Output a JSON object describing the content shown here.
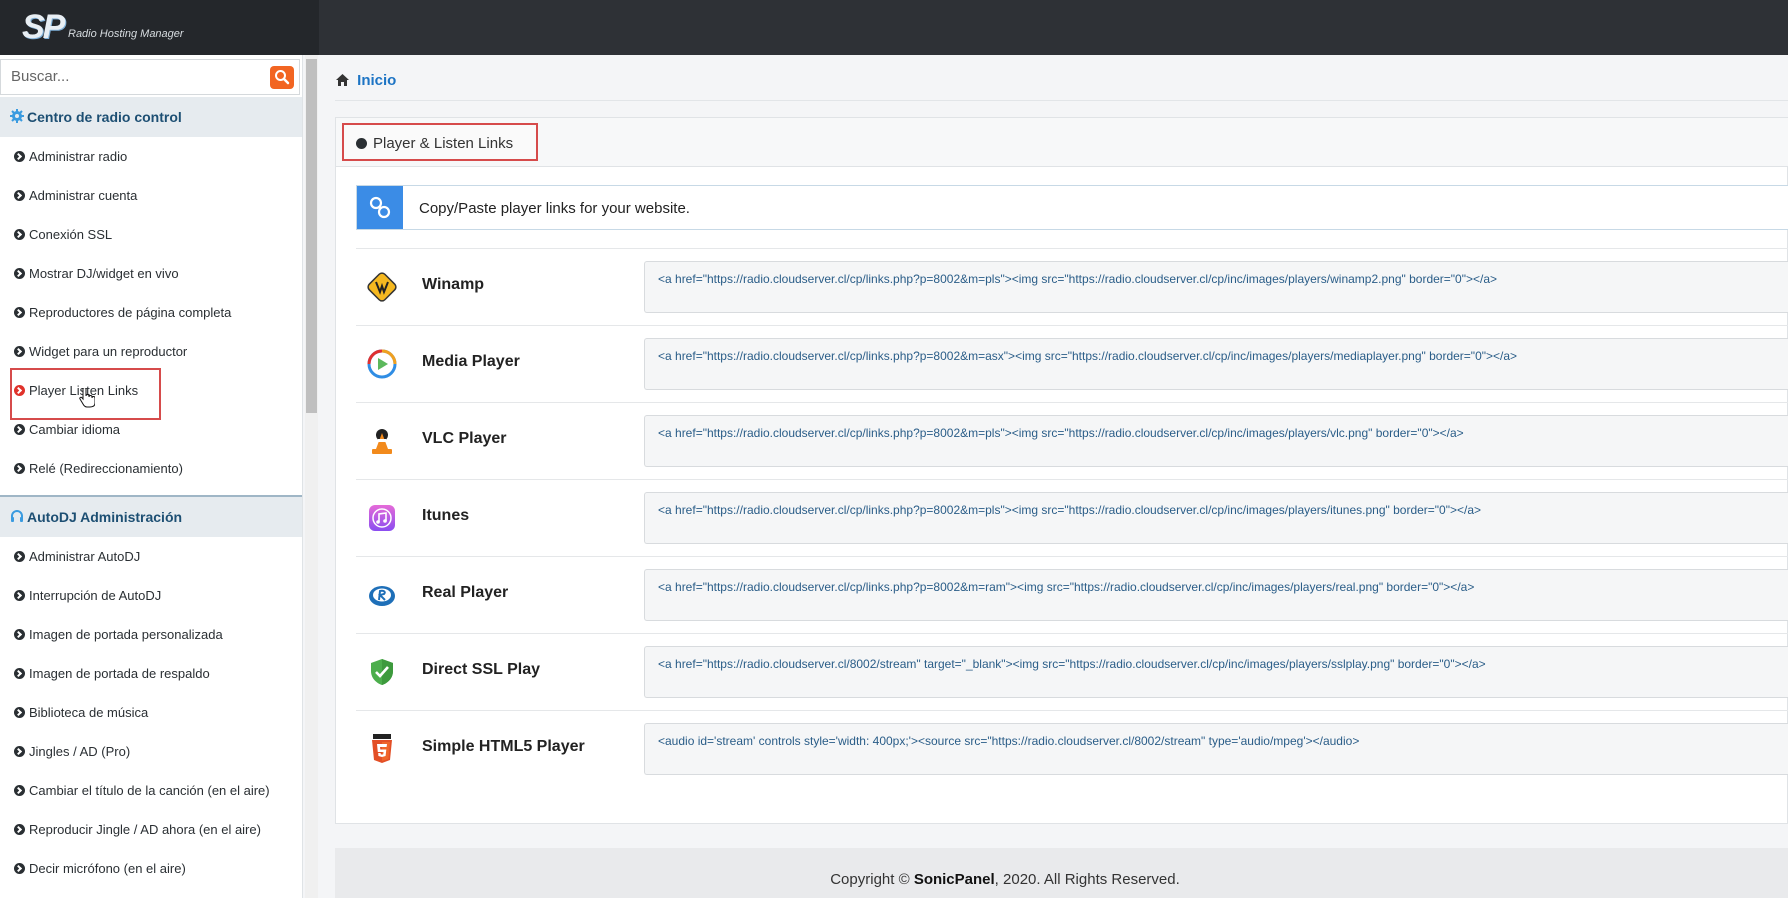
{
  "brand": {
    "logo_mark": "SP",
    "logo_subtitle": "Radio Hosting Manager"
  },
  "search": {
    "placeholder": "Buscar...",
    "icon": "search-icon"
  },
  "sidebar": {
    "sections": [
      {
        "title": "Centro de radio control",
        "icon": "gear-icon",
        "items": [
          {
            "label": "Administrar radio"
          },
          {
            "label": "Administrar cuenta"
          },
          {
            "label": "Conexión SSL"
          },
          {
            "label": "Mostrar DJ/widget en vivo"
          },
          {
            "label": "Reproductores de página completa"
          },
          {
            "label": "Widget para un reproductor"
          },
          {
            "label": "Player Listen Links",
            "active": true
          },
          {
            "label": "Cambiar idioma"
          },
          {
            "label": "Relé (Redireccionamiento)"
          }
        ]
      },
      {
        "title": "AutoDJ Administración",
        "icon": "headphones-icon",
        "items": [
          {
            "label": "Administrar AutoDJ"
          },
          {
            "label": "Interrupción de AutoDJ"
          },
          {
            "label": "Imagen de portada personalizada"
          },
          {
            "label": "Imagen de portada de respaldo"
          },
          {
            "label": "Biblioteca de música"
          },
          {
            "label": "Jingles / AD (Pro)"
          },
          {
            "label": "Cambiar el título de la canción (en el aire)"
          },
          {
            "label": "Reproducir Jingle / AD ahora (en el aire)"
          },
          {
            "label": "Decir micrófono (en el aire)"
          }
        ]
      }
    ]
  },
  "breadcrumb": {
    "label": "Inicio",
    "icon": "home-icon"
  },
  "panel": {
    "title": "Player & Listen Links",
    "info": "Copy/Paste player links for your website.",
    "info_icon": "link-icon"
  },
  "players": [
    {
      "name": "Winamp",
      "icon": "winamp-icon",
      "code": "<a href=\"https://radio.cloudserver.cl/cp/links.php?p=8002&m=pls\"><img src=\"https://radio.cloudserver.cl/cp/inc/images/players/winamp2.png\" border=\"0\"></a>"
    },
    {
      "name": "Media Player",
      "icon": "media-player-icon",
      "code": "<a href=\"https://radio.cloudserver.cl/cp/links.php?p=8002&m=asx\"><img src=\"https://radio.cloudserver.cl/cp/inc/images/players/mediaplayer.png\" border=\"0\"></a>"
    },
    {
      "name": "VLC Player",
      "icon": "vlc-icon",
      "code": "<a href=\"https://radio.cloudserver.cl/cp/links.php?p=8002&m=pls\"><img src=\"https://radio.cloudserver.cl/cp/inc/images/players/vlc.png\" border=\"0\"></a>"
    },
    {
      "name": "Itunes",
      "icon": "itunes-icon",
      "code": "<a href=\"https://radio.cloudserver.cl/cp/links.php?p=8002&m=pls\"><img src=\"https://radio.cloudserver.cl/cp/inc/images/players/itunes.png\" border=\"0\"></a>"
    },
    {
      "name": "Real Player",
      "icon": "real-player-icon",
      "code": "<a href=\"https://radio.cloudserver.cl/cp/links.php?p=8002&m=ram\"><img src=\"https://radio.cloudserver.cl/cp/inc/images/players/real.png\" border=\"0\"></a>"
    },
    {
      "name": "Direct SSL Play",
      "icon": "ssl-shield-icon",
      "code": "<a href=\"https://radio.cloudserver.cl/8002/stream\" target=\"_blank\"><img src=\"https://radio.cloudserver.cl/cp/inc/images/players/sslplay.png\" border=\"0\"></a>"
    },
    {
      "name": "Simple HTML5 Player",
      "icon": "html5-icon",
      "code": "<audio id='stream' controls style='width: 400px;'><source src=\"https://radio.cloudserver.cl/8002/stream\" type='audio/mpeg'></audio>"
    }
  ],
  "footer": {
    "prefix": "Copyright © ",
    "brand": "SonicPanel",
    "suffix": ", 2020. All Rights Reserved."
  },
  "colors": {
    "accent": "#1d74c4",
    "highlight": "#d64b4b",
    "search_button": "#f26522",
    "topbar": "#2e3136"
  }
}
